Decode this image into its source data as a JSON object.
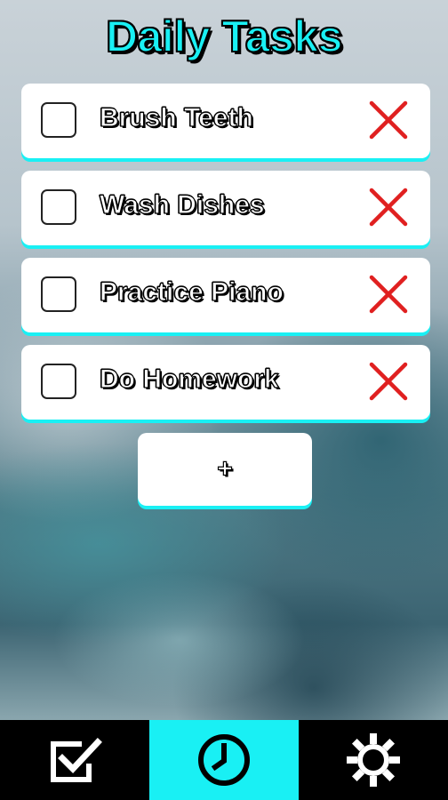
{
  "header": {
    "title": "Daily Tasks"
  },
  "tasks": [
    {
      "label": "Brush Teeth",
      "checked": false
    },
    {
      "label": "Wash Dishes",
      "checked": false
    },
    {
      "label": "Practice Piano",
      "checked": false
    },
    {
      "label": "Do Homework",
      "checked": false
    }
  ],
  "add_button": {
    "label": "+"
  },
  "nav": {
    "tabs": [
      {
        "icon": "checkbox-check-icon",
        "active": false
      },
      {
        "icon": "clock-icon",
        "active": true
      },
      {
        "icon": "gear-icon",
        "active": false
      }
    ]
  },
  "colors": {
    "accent": "#19f0f4",
    "delete": "#e02020",
    "nav_background": "#000000"
  }
}
